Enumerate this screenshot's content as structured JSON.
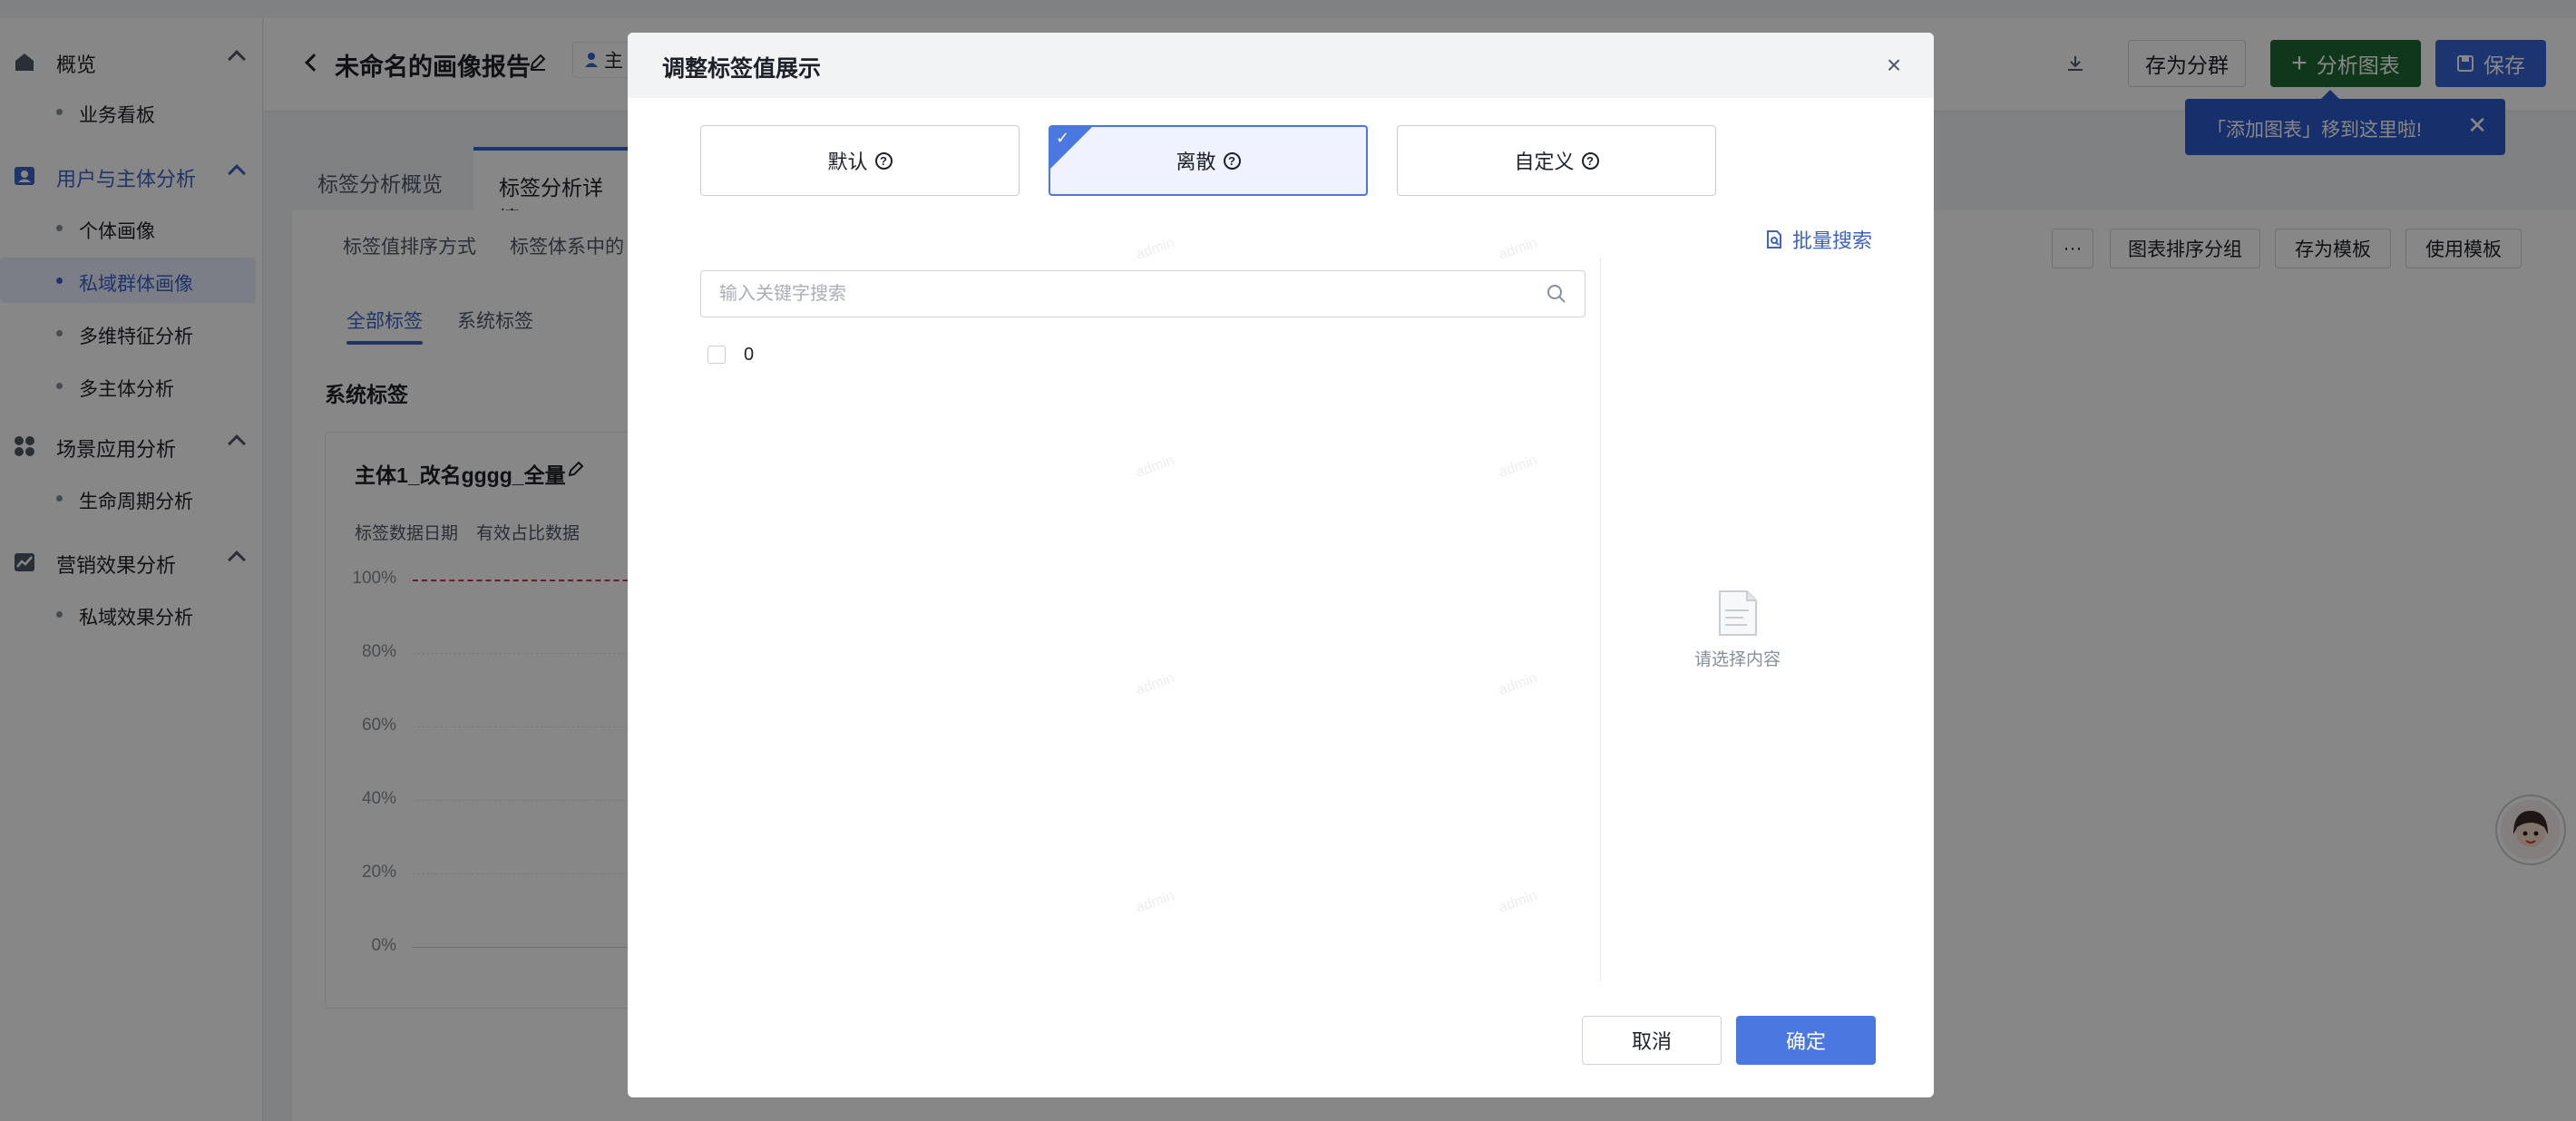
{
  "sidebar": {
    "groups": [
      {
        "label": "概览",
        "items": [
          "业务看板"
        ]
      },
      {
        "label": "用户与主体分析",
        "items": [
          "个体画像",
          "私域群体画像",
          "多维特征分析",
          "多主体分析"
        ]
      },
      {
        "label": "场景应用分析",
        "items": [
          "生命周期分析"
        ]
      },
      {
        "label": "营销效果分析",
        "items": [
          "私域效果分析"
        ]
      }
    ],
    "active_item": "私域群体画像"
  },
  "header": {
    "title": "未命名的画像报告",
    "subject_tag": "主",
    "buttons": {
      "save_group": "存为分群",
      "analysis_chart": "分析图表",
      "save": "保存"
    }
  },
  "tooltip": {
    "text": "「添加图表」移到这里啦!",
    "close": "✕"
  },
  "tabs": {
    "overview": "标签分析概览",
    "detail": "标签分析详情"
  },
  "toolbar": {
    "sort_label": "标签值排序方式",
    "system_label": "标签体系中的",
    "more": "···",
    "chart_sort_group": "图表排序分组",
    "save_template": "存为模板",
    "use_template": "使用模板"
  },
  "subtabs": {
    "all": "全部标签",
    "system": "系统标签"
  },
  "section_title": "系统标签",
  "card": {
    "title": "主体1_改名gggg_全量",
    "meta_date": "标签数据日期",
    "meta_ratio": "有效占比数据",
    "y_ticks": [
      "100%",
      "80%",
      "60%",
      "40%",
      "20%",
      "0%"
    ]
  },
  "modal": {
    "title": "调整标签值展示",
    "close": "×",
    "modes": [
      {
        "label": "默认",
        "selected": false
      },
      {
        "label": "离散",
        "selected": true
      },
      {
        "label": "自定义",
        "selected": false
      }
    ],
    "batch_search": "批量搜索",
    "search_placeholder": "输入关键字搜索",
    "options": [
      {
        "label": "0",
        "checked": false
      }
    ],
    "empty_text": "请选择内容",
    "cancel": "取消",
    "confirm": "确定"
  },
  "watermark": "admin",
  "colors": {
    "primary": "#4a78e0",
    "sidebar_active": "#3b62c4",
    "analysis_btn": "#1c6b30",
    "tooltip_bg": "#2d5ac9"
  }
}
